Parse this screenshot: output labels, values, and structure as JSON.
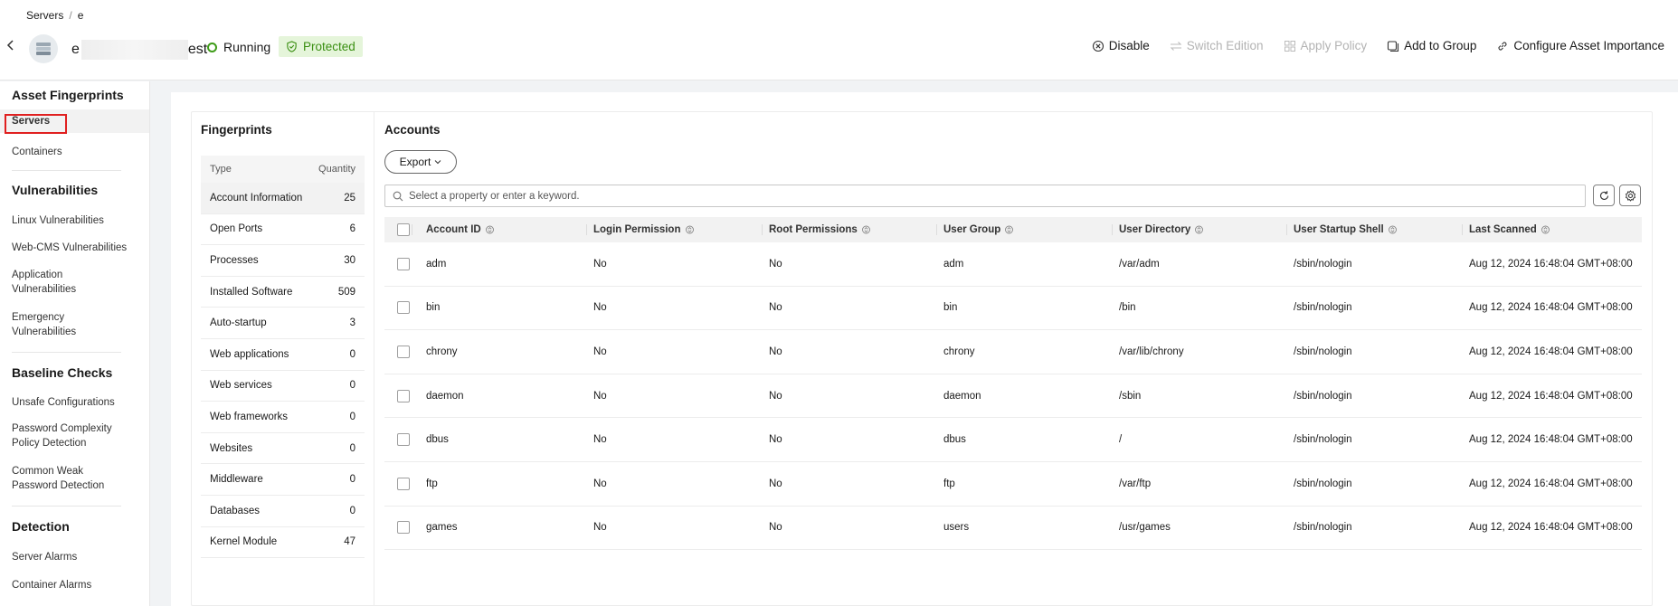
{
  "breadcrumb": {
    "root": "Servers",
    "separator": "/",
    "current": "e"
  },
  "server": {
    "name_prefix": "e",
    "name_suffix": "est",
    "status": "Running",
    "protection": "Protected"
  },
  "header_actions": [
    {
      "label": "Disable",
      "icon": "close-circle-icon",
      "enabled": true
    },
    {
      "label": "Switch Edition",
      "icon": "switch-icon",
      "enabled": false
    },
    {
      "label": "Apply Policy",
      "icon": "policy-icon",
      "enabled": false
    },
    {
      "label": "Add to Group",
      "icon": "group-icon",
      "enabled": true
    },
    {
      "label": "Configure Asset Importance",
      "icon": "link-icon",
      "enabled": true
    }
  ],
  "nav": {
    "asset_fingerprints": "Asset Fingerprints",
    "servers": "Servers",
    "containers": "Containers",
    "vulnerabilities": "Vulnerabilities",
    "linux_vulns": "Linux Vulnerabilities",
    "webcms_vulns": "Web-CMS Vulnerabilities",
    "app_vulns_1": "Application",
    "app_vulns_2": "Vulnerabilities",
    "emergency_vulns_1": "Emergency",
    "emergency_vulns_2": "Vulnerabilities",
    "baseline_checks": "Baseline Checks",
    "unsafe_configs": "Unsafe Configurations",
    "pwd_complexity_1": "Password Complexity",
    "pwd_complexity_2": "Policy Detection",
    "weak_pwd_1": "Common Weak",
    "weak_pwd_2": "Password Detection",
    "detection": "Detection",
    "server_alarms": "Server Alarms",
    "container_alarms": "Container Alarms"
  },
  "fingerprints": {
    "title": "Fingerprints",
    "col_type": "Type",
    "col_quantity": "Quantity",
    "rows": [
      {
        "type": "Account Information",
        "quantity": "25"
      },
      {
        "type": "Open Ports",
        "quantity": "6"
      },
      {
        "type": "Processes",
        "quantity": "30"
      },
      {
        "type": "Installed Software",
        "quantity": "509"
      },
      {
        "type": "Auto-startup",
        "quantity": "3"
      },
      {
        "type": "Web applications",
        "quantity": "0"
      },
      {
        "type": "Web services",
        "quantity": "0"
      },
      {
        "type": "Web frameworks",
        "quantity": "0"
      },
      {
        "type": "Websites",
        "quantity": "0"
      },
      {
        "type": "Middleware",
        "quantity": "0"
      },
      {
        "type": "Databases",
        "quantity": "0"
      },
      {
        "type": "Kernel Module",
        "quantity": "47"
      }
    ]
  },
  "accounts": {
    "title": "Accounts",
    "export_label": "Export",
    "search_placeholder": "Select a property or enter a keyword.",
    "columns": [
      "Account ID",
      "Login Permission",
      "Root Permissions",
      "User Group",
      "User Directory",
      "User Startup Shell",
      "Last Scanned"
    ],
    "rows": [
      [
        "adm",
        "No",
        "No",
        "adm",
        "/var/adm",
        "/sbin/nologin",
        "Aug 12, 2024 16:48:04 GMT+08:00"
      ],
      [
        "bin",
        "No",
        "No",
        "bin",
        "/bin",
        "/sbin/nologin",
        "Aug 12, 2024 16:48:04 GMT+08:00"
      ],
      [
        "chrony",
        "No",
        "No",
        "chrony",
        "/var/lib/chrony",
        "/sbin/nologin",
        "Aug 12, 2024 16:48:04 GMT+08:00"
      ],
      [
        "daemon",
        "No",
        "No",
        "daemon",
        "/sbin",
        "/sbin/nologin",
        "Aug 12, 2024 16:48:04 GMT+08:00"
      ],
      [
        "dbus",
        "No",
        "No",
        "dbus",
        "/",
        "/sbin/nologin",
        "Aug 12, 2024 16:48:04 GMT+08:00"
      ],
      [
        "ftp",
        "No",
        "No",
        "ftp",
        "/var/ftp",
        "/sbin/nologin",
        "Aug 12, 2024 16:48:04 GMT+08:00"
      ],
      [
        "games",
        "No",
        "No",
        "users",
        "/usr/games",
        "/sbin/nologin",
        "Aug 12, 2024 16:48:04 GMT+08:00"
      ]
    ]
  },
  "colors": {
    "accent_green": "#3a8f12",
    "protected_bg": "#e5f5da",
    "highlight_red": "#e02020"
  }
}
